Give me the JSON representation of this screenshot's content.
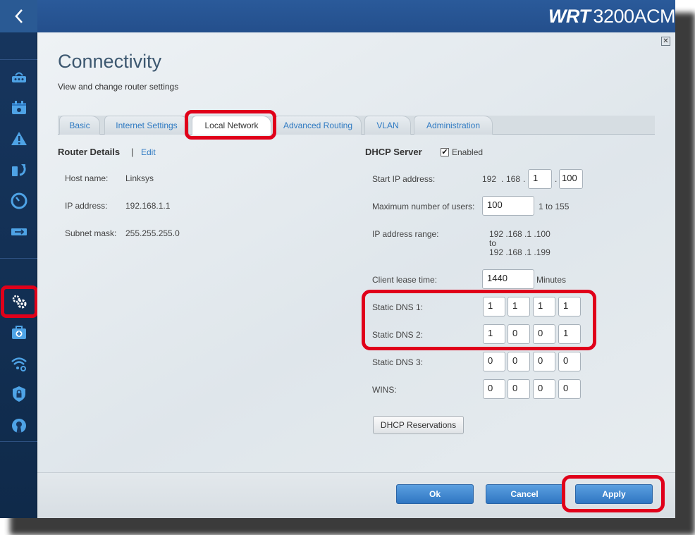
{
  "brand": {
    "logo": "WRT",
    "model": "3200ACM"
  },
  "page": {
    "title": "Connectivity",
    "subtitle": "View and change router settings"
  },
  "tabs": [
    {
      "label": "Basic",
      "active": false
    },
    {
      "label": "Internet Settings",
      "active": false
    },
    {
      "label": "Local Network",
      "active": true
    },
    {
      "label": "Advanced Routing",
      "active": false
    },
    {
      "label": "VLAN",
      "active": false
    },
    {
      "label": "Administration",
      "active": false
    }
  ],
  "sidebar": {
    "icons": [
      "back-arrow-icon",
      "router-icon",
      "calendar-icon",
      "network-warning-icon",
      "refresh-icon",
      "speed-test-icon",
      "usb-icon",
      "settings-gear-icon",
      "first-aid-icon",
      "wifi-settings-icon",
      "security-shield-icon",
      "open-vpn-icon"
    ]
  },
  "router_details": {
    "title": "Router Details",
    "separator": "|",
    "edit_label": "Edit",
    "rows": [
      {
        "label": "Host name:",
        "value": "Linksys"
      },
      {
        "label": "IP address:",
        "value": "192.168.1.1"
      },
      {
        "label": "Subnet mask:",
        "value": "255.255.255.0"
      }
    ]
  },
  "dhcp": {
    "title": "DHCP Server",
    "enabled_label": "Enabled",
    "enabled_mark": "✔",
    "start_ip": {
      "label": "Start IP address:",
      "part1": "192",
      "part2": "168",
      "part3": "1",
      "part4": "100",
      "dot": "."
    },
    "max_users": {
      "label": "Maximum number of users:",
      "value": "100",
      "range": "1 to 155"
    },
    "ip_range": {
      "label": "IP address range:",
      "from": "192 .168 .1 .100",
      "to_word": "to",
      "to": "192 .168 .1 .199"
    },
    "lease": {
      "label": "Client lease time:",
      "value": "1440",
      "unit": "Minutes"
    },
    "dns1": {
      "label": "Static DNS 1:",
      "octets": [
        "1",
        "1",
        "1",
        "1"
      ]
    },
    "dns2": {
      "label": "Static DNS 2:",
      "octets": [
        "1",
        "0",
        "0",
        "1"
      ]
    },
    "dns3": {
      "label": "Static DNS 3:",
      "octets": [
        "0",
        "0",
        "0",
        "0"
      ]
    },
    "wins": {
      "label": "WINS:",
      "octets": [
        "0",
        "0",
        "0",
        "0"
      ]
    },
    "reservations_label": "DHCP Reservations"
  },
  "footer": {
    "ok_label": "Ok",
    "cancel_label": "Cancel",
    "apply_label": "Apply"
  },
  "colors": {
    "highlight": "#e0001a",
    "accent_blue": "#2f7ac2",
    "sidebar": "#17365f",
    "topbar": "#2a5a9a"
  }
}
